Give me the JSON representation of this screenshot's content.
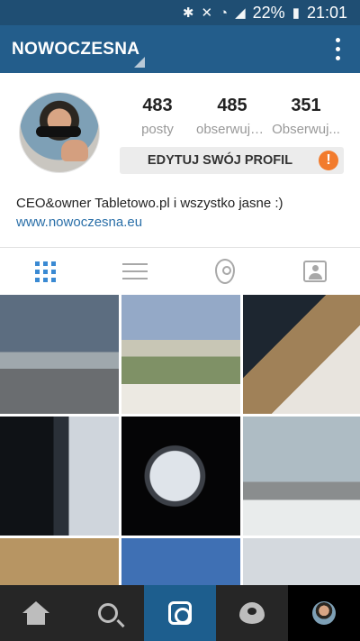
{
  "status_bar": {
    "battery_percent": "22%",
    "time": "21:01",
    "icons": [
      "bluetooth-icon",
      "mute-icon",
      "wifi-icon",
      "signal-icon",
      "battery-icon"
    ]
  },
  "app_bar": {
    "username": "NOWOCZESNA",
    "menu_icon": "overflow-menu-icon"
  },
  "profile": {
    "stats": [
      {
        "value": "483",
        "label": "posty"
      },
      {
        "value": "485",
        "label": "obserwują..."
      },
      {
        "value": "351",
        "label": "Obserwuj..."
      }
    ],
    "edit_button_label": "EDYTUJ SWÓJ PROFIL",
    "warning_symbol": "!",
    "bio": "CEO&owner Tabletowo.pl i wszystko jasne :)",
    "website": "www.nowoczesna.eu"
  },
  "tabs": [
    {
      "icon": "grid-icon",
      "active": true
    },
    {
      "icon": "list-icon",
      "active": false
    },
    {
      "icon": "location-pin-icon",
      "active": false
    },
    {
      "icon": "tagged-person-icon",
      "active": false
    }
  ],
  "photos": [
    "photo-1",
    "photo-2",
    "photo-3",
    "photo-4",
    "photo-5",
    "photo-6",
    "photo-7",
    "photo-8",
    "photo-9"
  ],
  "bottom_nav": [
    {
      "icon": "home-icon"
    },
    {
      "icon": "search-icon"
    },
    {
      "icon": "camera-icon",
      "active": true
    },
    {
      "icon": "activity-heart-icon"
    },
    {
      "icon": "profile-avatar-icon"
    }
  ],
  "colors": {
    "status_bar": "#1f4e73",
    "app_bar": "#235d8b",
    "accent_blue": "#3a8ad3",
    "warning": "#f27b2d",
    "bottom_bar": "#262626"
  }
}
